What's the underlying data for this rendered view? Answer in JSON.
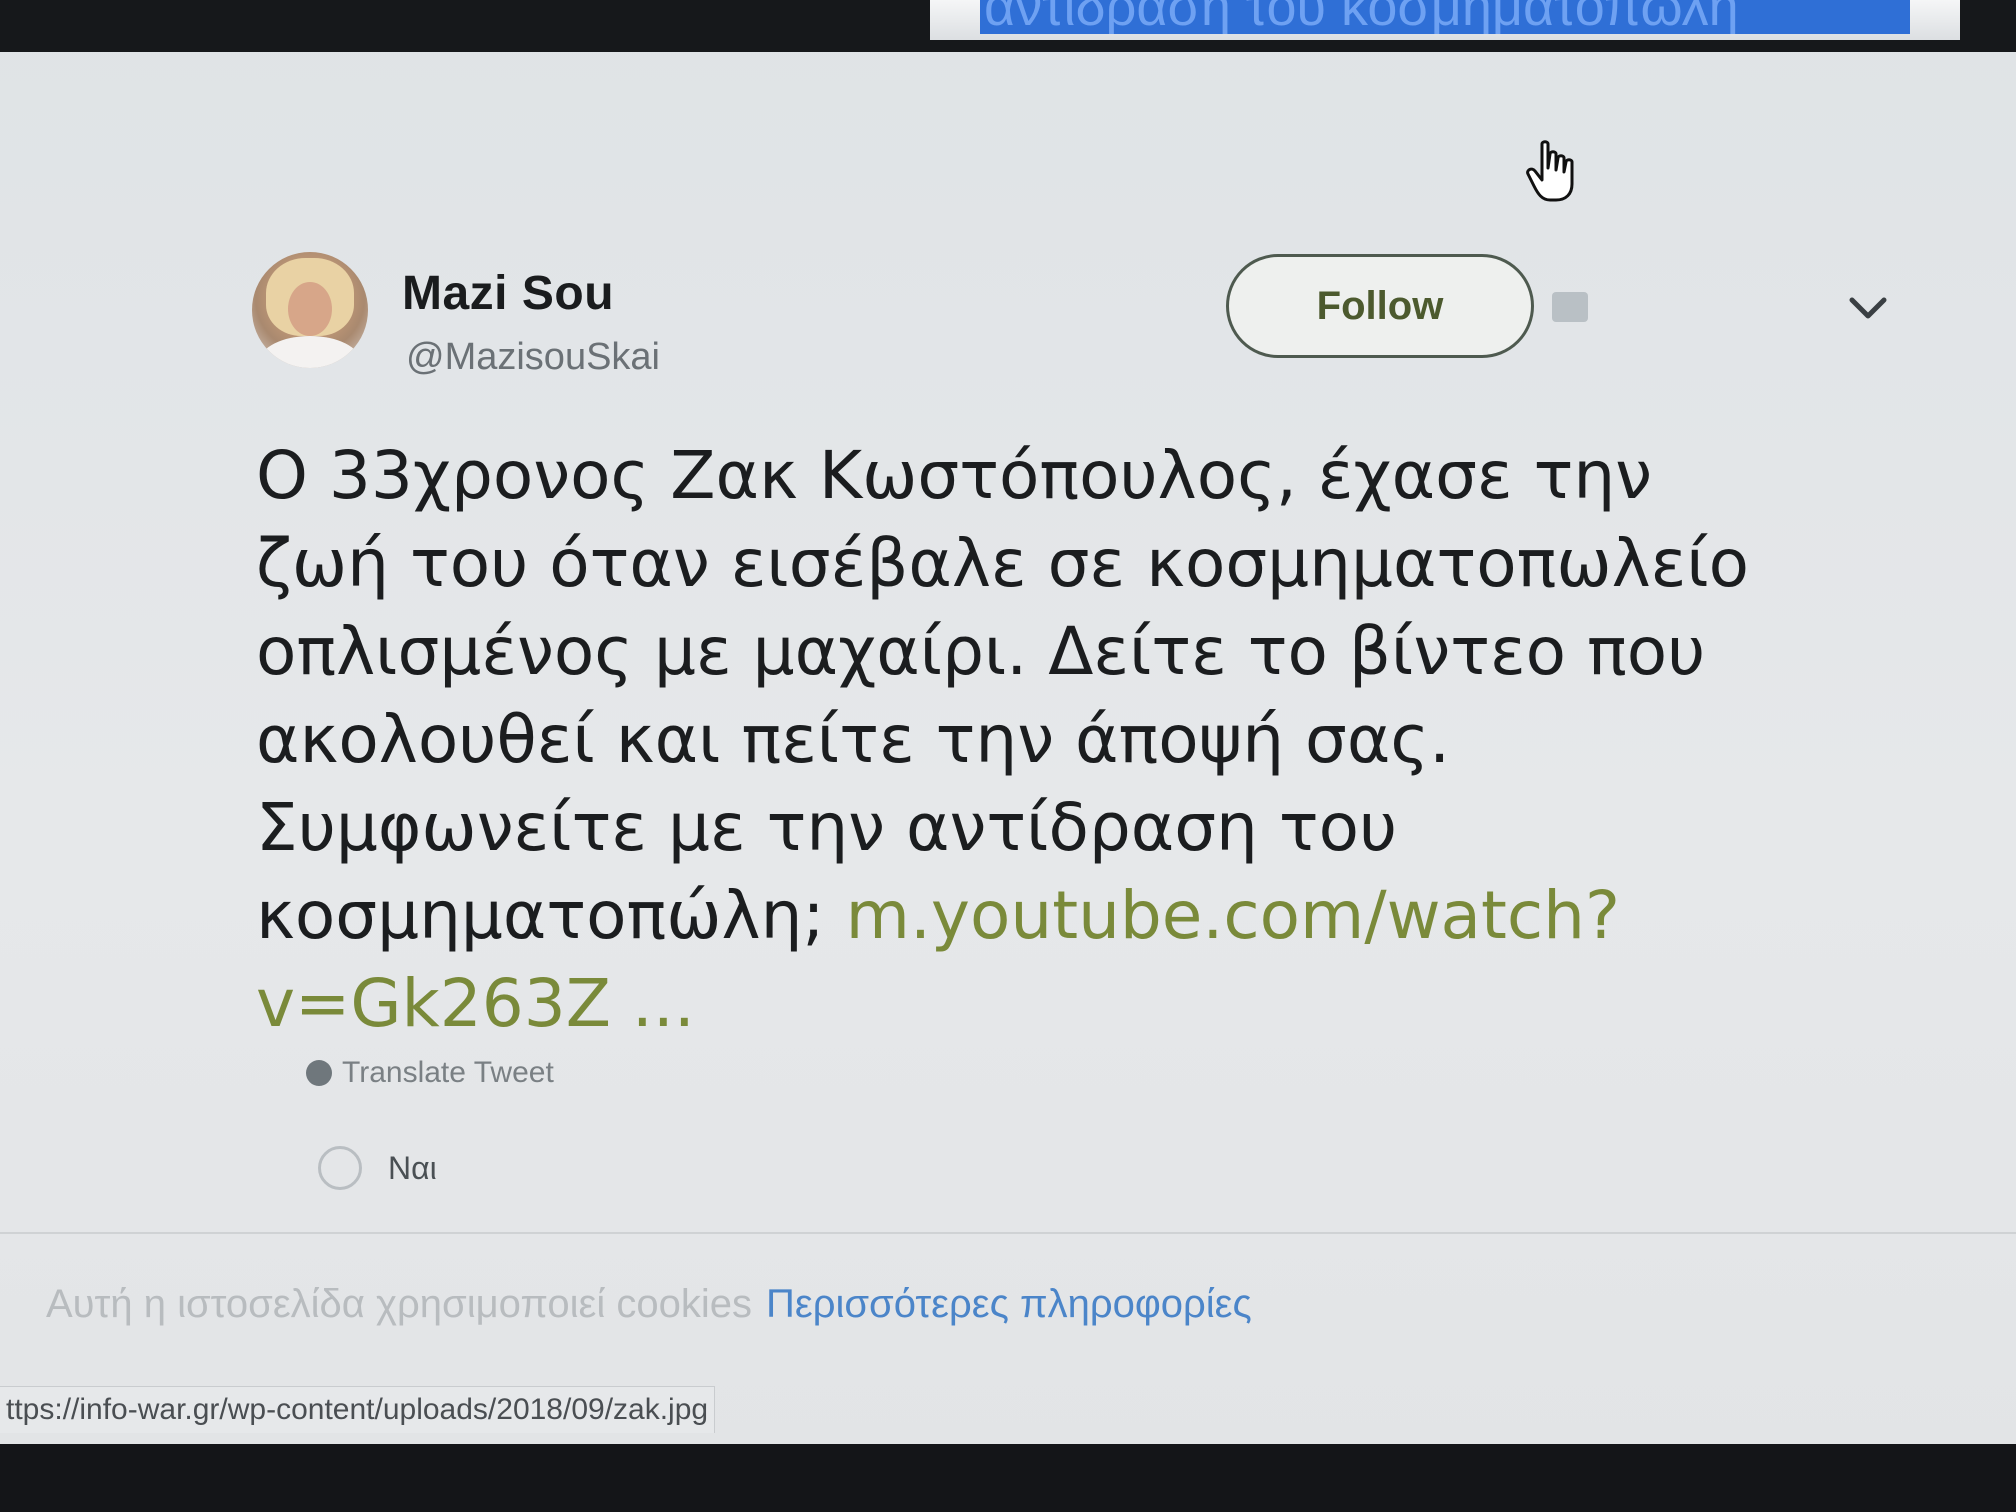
{
  "top_banner": {
    "text": "αντίδραση του κοσμηματοπώλη"
  },
  "tweet": {
    "display_name": "Mazi Sou",
    "handle": "@MazisouSkai",
    "follow_label": "Follow",
    "text_lines": [
      "Ο 33χρονος Ζακ Κωστόπουλος, έχασε την",
      "ζωή του όταν εισέβαλε σε κοσμηματοπωλείο",
      "οπλισμένος με μαχαίρι. Δείτε το βίντεο που",
      "ακολουθεί και πείτε την άποψή σας.",
      "Συμφωνείτε με την αντίδραση του"
    ],
    "last_line_text": "κοσμηματοπώλη; ",
    "link_part1": "m.youtube.com/watch?",
    "link_part2": "v=Gk263Z ...",
    "translate_label": "Translate Tweet",
    "poll_option_label": "Ναι"
  },
  "cookie_notice": {
    "text": "Αυτή η ιστοσελίδα χρησιμοποιεί cookies",
    "link_label": "Περισσότερες πληροφορίες"
  },
  "status_bar": {
    "url": "ttps://info-war.gr/wp-content/uploads/2018/09/zak.jpg"
  },
  "colors": {
    "link": "#7a8a3a",
    "cookie_link": "#4b85c9",
    "banner": "#2f6fd6"
  },
  "icons": {
    "caret": "chevron-down-icon",
    "translate": "globe-icon",
    "cursor": "hand-pointer-icon"
  }
}
